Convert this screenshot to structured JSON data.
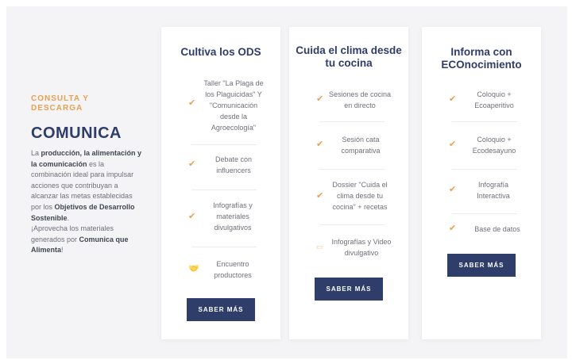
{
  "intro": {
    "eyebrow": "CONSULTA Y DESCARGA",
    "title": "COMUNICA",
    "text": [
      {
        "t": "La ",
        "b": false
      },
      {
        "t": "producción, la alimentación y la comunicación",
        "b": true
      },
      {
        "t": " es la combinación ideal para impulsar acciones que contribuyan a alcanzar las metas establecidas por los ",
        "b": false
      },
      {
        "t": "Objetivos de Desarrollo Sostenible",
        "b": true
      },
      {
        "t": ".",
        "b": false
      },
      {
        "t": "\n¡Aprovecha los materiales generados por ",
        "b": false
      },
      {
        "t": "Comunica que Alimenta",
        "b": true
      },
      {
        "t": "!",
        "b": false
      }
    ]
  },
  "cards": [
    {
      "title": "Cultiva los ODS",
      "items": [
        {
          "icon": "check-icon",
          "text": "Taller \"La Plaga de los Plaguicidas\" Y \"Comunicación desde la Agroecología\""
        },
        {
          "icon": "check-icon",
          "text": "Debate con influencers"
        },
        {
          "icon": "check-icon",
          "text": "Infografías y materiales divulgativos"
        },
        {
          "icon": "handshake-icon",
          "text": "Encuentro productores"
        }
      ],
      "button": "SABER MÁS"
    },
    {
      "title": "Cuida el clima desde tu cocina",
      "items": [
        {
          "icon": "check-icon",
          "text": "Sesiones de cocina en directo"
        },
        {
          "icon": "check-icon",
          "text": "Sesión cata comparativa"
        },
        {
          "icon": "check-icon",
          "text": "Dossier \"Cuida el clima desde tu cocina\" + recetas"
        },
        {
          "icon": "video-icon",
          "text": "Infografías y Video divulgativo"
        }
      ],
      "button": "SABER MÁS"
    },
    {
      "title": "Informa con ECOnocimiento",
      "items": [
        {
          "icon": "check-icon",
          "text": "Coloquio + Ecoaperitivo"
        },
        {
          "icon": "check-icon",
          "text": "Coloquio + Ecodesayuno"
        },
        {
          "icon": "check-icon",
          "text": "Infografía Interactiva"
        },
        {
          "icon": "check-icon",
          "text": "Base de datos"
        }
      ],
      "button": "SABER MÁS"
    }
  ]
}
